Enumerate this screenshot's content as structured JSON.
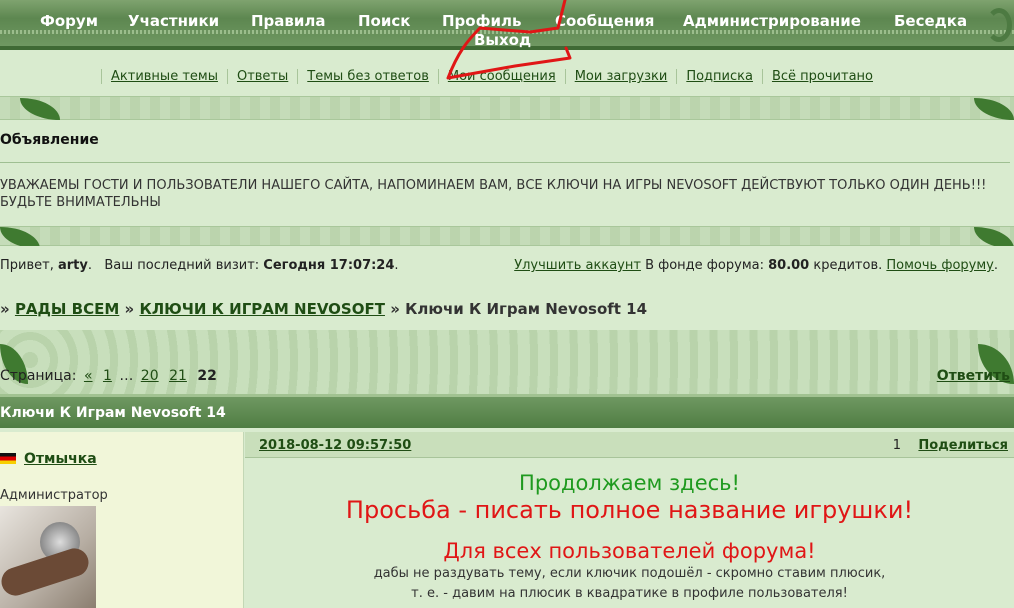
{
  "nav": {
    "items": [
      "Форум",
      "Участники",
      "Правила",
      "Поиск",
      "Профиль",
      "Сообщения",
      "Администрирование",
      "Беседка"
    ],
    "logout": "Выход"
  },
  "subnav": [
    "Активные темы",
    "Ответы",
    "Темы без ответов",
    "Мои сообщения",
    "Мои загрузки",
    "Подписка",
    "Всё прочитано"
  ],
  "announcement": {
    "title": "Объявление",
    "text": "УВАЖАЕМЫ ГОСТИ И ПОЛЬЗОВАТЕЛИ НАШЕГО САЙТА, НАПОМИНАЕМ ВАМ, ВСЕ КЛЮЧИ НА ИГРЫ NEVOSOFT ДЕЙСТВУЮТ ТОЛЬКО ОДИН ДЕНЬ!!! БУДЬТЕ ВНИМАТЕЛЬНЫ"
  },
  "greeting": {
    "hello": "Привет,",
    "user": "arty",
    "last_visit_label": "Ваш последний визит:",
    "last_visit": "Сегодня 17:07:24",
    "upgrade_link": "Улучшить аккаунт",
    "fund_label": "В фонде форума:",
    "fund_amount": "80.00",
    "fund_unit": "кредитов.",
    "help_link": "Помочь форуму"
  },
  "breadcrumb": {
    "sep": "»",
    "root": "РАДЫ ВСЕМ",
    "section": "КЛЮЧИ К ИГРАМ NEVOSOFT",
    "current": "Ключи К Играм Nevosoft 14"
  },
  "pager": {
    "label": "Страница:",
    "prev": "«",
    "first": "1",
    "ellipsis": "…",
    "p20": "20",
    "p21": "21",
    "current": "22",
    "reply": "Ответить"
  },
  "topic_title": "Ключи К Играм Nevosoft 14",
  "post": {
    "author": "Отмычка",
    "role": "Администратор",
    "date": "2018-08-12 09:57:50",
    "number": "1",
    "share": "Поделиться",
    "line1": "Продолжаем здесь!",
    "line2": "Просьба - писать полное название игрушки!",
    "line3": "Для всех пользователей форума!",
    "line4": "дабы не раздувать тему, если ключик подошёл - скромно ставим плюсик,",
    "line5": "т. е. - давим на плюсик в квадратике в профиле пользователя!"
  },
  "colors": {
    "nav_green": "#5d8750",
    "link": "#1f4d14",
    "green_text": "#1f9a1f",
    "red_text": "#e01616",
    "annotation": "#e01616"
  }
}
